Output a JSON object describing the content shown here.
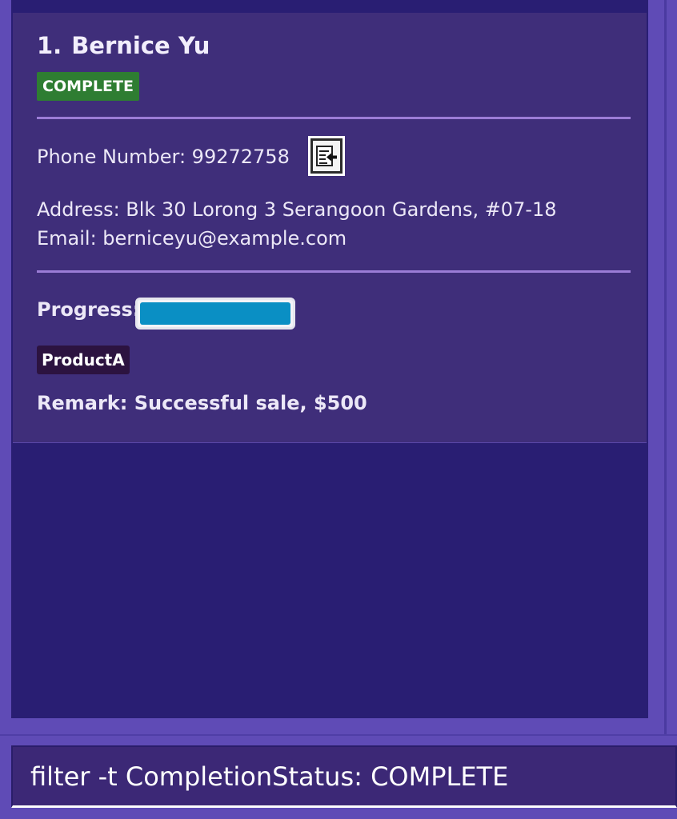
{
  "person": {
    "index": "1.",
    "name": "Bernice Yu",
    "status": "COMPLETE",
    "phone_line": "Phone Number: 99272758",
    "address_line": "Address: Blk 30 Lorong 3 Serangoon Gardens, #07-18",
    "email_line": "Email: berniceyu@example.com",
    "progress_label": "Progress:",
    "progress_fraction": 1.0,
    "tags": [
      "ProductA"
    ],
    "remark_line": "Remark: Successful sale, $500"
  },
  "icons": {
    "copy": "copy-to-clipboard-icon"
  },
  "command": {
    "value": "filter -t CompletionStatus: COMPLETE"
  },
  "colors": {
    "status_complete": "#2e7d32",
    "progress_fill": "#0a8fc4",
    "tag_bg": "#2c1340"
  }
}
